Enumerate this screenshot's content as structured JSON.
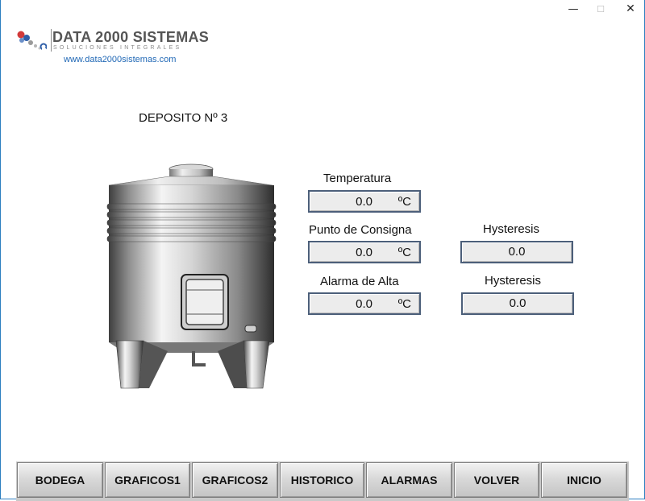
{
  "window_controls": {
    "minimize": "—",
    "maximize": "☐",
    "close": "✕"
  },
  "logo": {
    "title": "DATA 2000 SISTEMAS",
    "subtitle": "SOLUCIONES INTEGRALES",
    "url": "www.data2000sistemas.com"
  },
  "page_title": "DEPOSITO Nº 3",
  "fields": {
    "temperatura": {
      "label": "Temperatura",
      "value": "0.0",
      "unit": "ºC"
    },
    "punto_consigna": {
      "label": "Punto de Consigna",
      "value": "0.0",
      "unit": "ºC"
    },
    "alarma_alta": {
      "label": "Alarma de Alta",
      "value": "0.0",
      "unit": "ºC"
    },
    "hysteresis_1": {
      "label": "Hysteresis",
      "value": "0.0"
    },
    "hysteresis_2": {
      "label": "Hysteresis",
      "value": "0.0"
    }
  },
  "nav": [
    "BODEGA",
    "GRAFICOS1",
    "GRAFICOS2",
    "HISTORICO",
    "ALARMAS",
    "VOLVER",
    "INICIO"
  ],
  "colors": {
    "window_border": "#2d7fc0",
    "field_border": "#4c5f7a",
    "url": "#1f67b5"
  }
}
